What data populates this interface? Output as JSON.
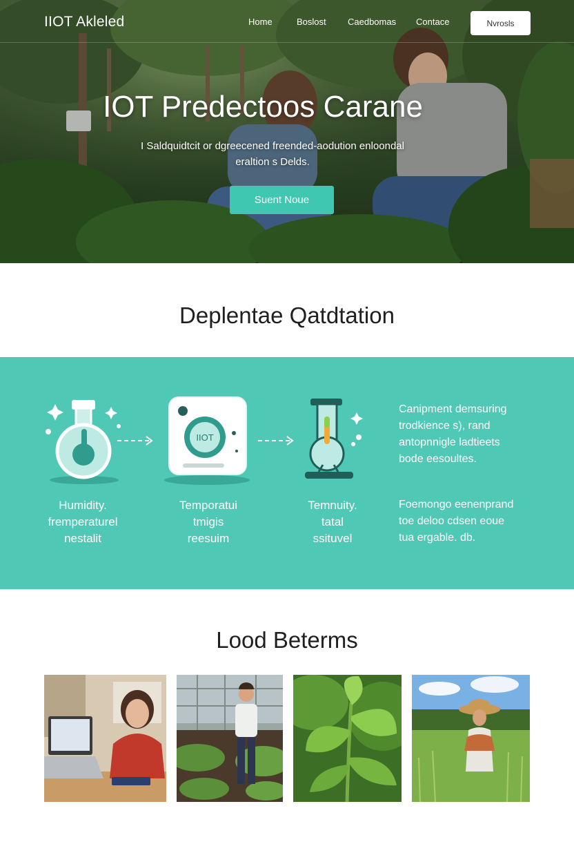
{
  "nav": {
    "logo": "IIOT Akleled",
    "links": [
      "Home",
      "Boslost",
      "Caedbomas",
      "Contace"
    ],
    "button": "Nvrosls"
  },
  "hero": {
    "title": "IOT Predectoos Carane",
    "subtitle": "I Saldquidtcit or dgreecened freended-aodution enloondal eraltion s Delds.",
    "cta": "Suent Noue"
  },
  "section_process": {
    "title": "Deplentae Qatdtation",
    "icons": [
      "flask-icon",
      "device-icon",
      "thermometer-icon"
    ],
    "device_screen_text": "IIOT",
    "steps": [
      {
        "lines": [
          "Humidity.",
          "fremperaturel",
          "nestalit"
        ]
      },
      {
        "lines": [
          "Temporatui",
          "tmigis",
          "reesuim"
        ]
      },
      {
        "lines": [
          "Temnuity.",
          "tatal",
          "ssituvel"
        ]
      }
    ],
    "text_blocks": [
      {
        "lines": [
          "Canipment demsuring",
          "trodkience s), rand",
          "antopnnigle ladtieets",
          "bode eesoultes."
        ]
      },
      {
        "lines": [
          "Foemongo eenenprand",
          "toe deloo cdsen eoue",
          "tua ergable. db."
        ]
      }
    ],
    "colors": {
      "band": "#4fc8b6",
      "accent": "#3fc7b1",
      "icon_dark": "#1f7a70"
    }
  },
  "section_gallery": {
    "title": "Lood Beterms",
    "photos": [
      "student-laptop-photo",
      "boy-garden-photo",
      "leaf-closeup-photo",
      "farmer-field-photo"
    ]
  }
}
